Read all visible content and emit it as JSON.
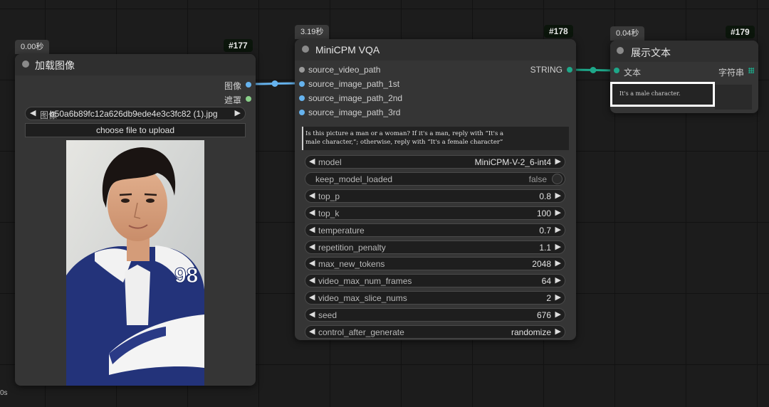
{
  "stray_label": "0s",
  "load_node": {
    "timing": "0.00秒",
    "id": "#177",
    "title": "加载图像",
    "outputs": [
      "图像",
      "遮罩"
    ],
    "image_widget_label": "图像",
    "image_widget_value": "b50a6b89fc12a626db9ede4e3c3fc82 (1).jpg",
    "upload_button": "choose file to upload"
  },
  "vqa_node": {
    "timing": "3.19秒",
    "id": "#178",
    "title": "MiniCPM VQA",
    "inputs": [
      "source_video_path",
      "source_image_path_1st",
      "source_image_path_2nd",
      "source_image_path_3rd"
    ],
    "output": "STRING",
    "prompt_line1": "Is this picture a man or a woman? If it's a man, reply with “It's a",
    "prompt_line2": "male character,”; otherwise, reply with “It's a female character”",
    "widgets": [
      {
        "label": "model",
        "value": "MiniCPM-V-2_6-int4"
      },
      {
        "label": "keep_model_loaded",
        "value": "false"
      },
      {
        "label": "top_p",
        "value": "0.8"
      },
      {
        "label": "top_k",
        "value": "100"
      },
      {
        "label": "temperature",
        "value": "0.7"
      },
      {
        "label": "repetition_penalty",
        "value": "1.1"
      },
      {
        "label": "max_new_tokens",
        "value": "2048"
      },
      {
        "label": "video_max_num_frames",
        "value": "64"
      },
      {
        "label": "video_max_slice_nums",
        "value": "2"
      },
      {
        "label": "seed",
        "value": "676"
      },
      {
        "label": "control_after_generate",
        "value": "randomize"
      }
    ]
  },
  "show_node": {
    "timing": "0.04秒",
    "id": "#179",
    "title": "展示文本",
    "input": "文本",
    "output": "字符串",
    "text": "It's a male character."
  },
  "colors": {
    "image_wire": "#66b3ee",
    "string_wire": "#1ea789",
    "highlight_box": "#ffffff"
  }
}
